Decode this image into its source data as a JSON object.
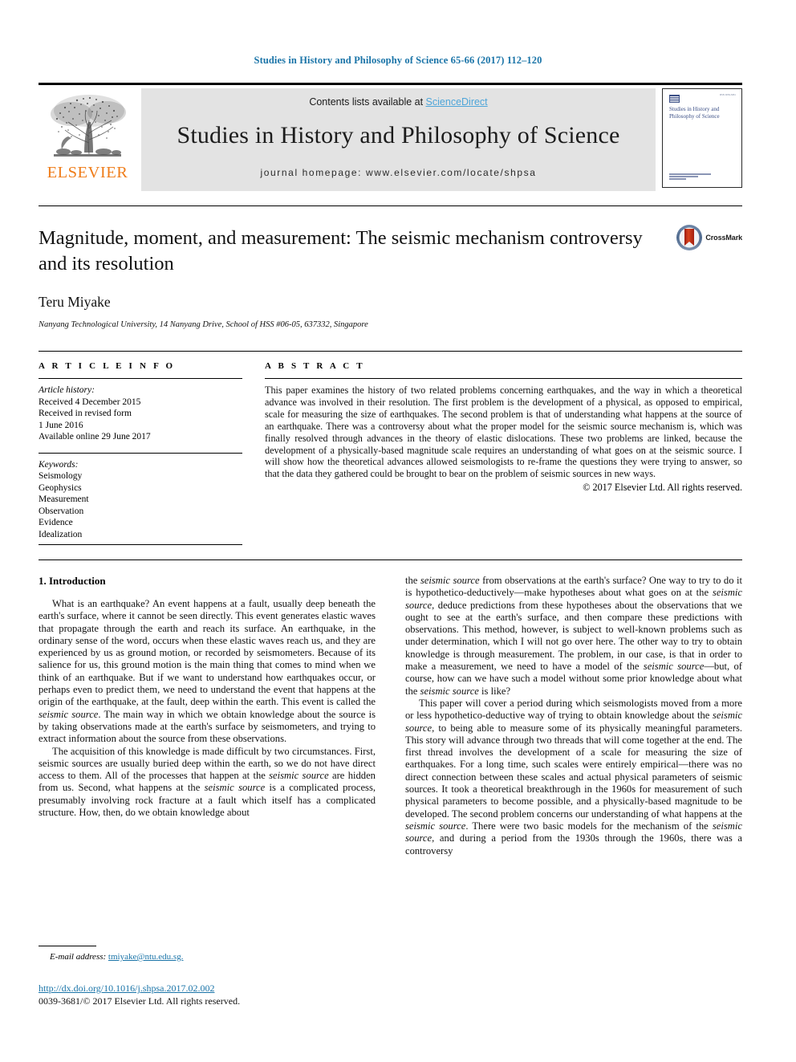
{
  "running_head": "Studies in History and Philosophy of Science 65-66 (2017) 112–120",
  "masthead": {
    "publisher_name": "ELSEVIER",
    "contents_prefix": "Contents lists available at ",
    "contents_link": "ScienceDirect",
    "journal_title": "Studies in History and Philosophy of Science",
    "homepage": "journal homepage: www.elsevier.com/locate/shpsa",
    "cover": {
      "title": "Studies in History and Philosophy of Science",
      "corner_note": "ISSN 0039-3681"
    }
  },
  "article": {
    "title": "Magnitude, moment, and measurement: The seismic mechanism controversy and its resolution",
    "author": "Teru Miyake",
    "affiliation": "Nanyang Technological University, 14 Nanyang Drive, School of HSS #06-05, 637332, Singapore",
    "crossmark_label": "CrossMark"
  },
  "article_info": {
    "heading": "A R T I C L E   I N F O",
    "history_label": "Article history:",
    "history": [
      "Received 4 December 2015",
      "Received in revised form",
      "1 June 2016",
      "Available online 29 June 2017"
    ],
    "keywords_label": "Keywords:",
    "keywords": [
      "Seismology",
      "Geophysics",
      "Measurement",
      "Observation",
      "Evidence",
      "Idealization"
    ]
  },
  "abstract": {
    "heading": "A B S T R A C T",
    "text": "This paper examines the history of two related problems concerning earthquakes, and the way in which a theoretical advance was involved in their resolution. The first problem is the development of a physical, as opposed to empirical, scale for measuring the size of earthquakes. The second problem is that of understanding what happens at the source of an earthquake. There was a controversy about what the proper model for the seismic source mechanism is, which was finally resolved through advances in the theory of elastic dislocations. These two problems are linked, because the development of a physically-based magnitude scale requires an understanding of what goes on at the seismic source. I will show how the theoretical advances allowed seismologists to re-frame the questions they were trying to answer, so that the data they gathered could be brought to bear on the problem of seismic sources in new ways.",
    "copyright": "© 2017 Elsevier Ltd. All rights reserved."
  },
  "body": {
    "section_number_title": "1. Introduction",
    "left_paragraph_1": "What is an earthquake? An event happens at a fault, usually deep beneath the earth's surface, where it cannot be seen directly. This event generates elastic waves that propagate through the earth and reach its surface. An earthquake, in the ordinary sense of the word, occurs when these elastic waves reach us, and they are experienced by us as ground motion, or recorded by seismometers. Because of its salience for us, this ground motion is the main thing that comes to mind when we think of an earthquake. But if we want to understand how earthquakes occur, or perhaps even to predict them, we need to understand the event that happens at the origin of the earthquake, at the fault, deep within the earth. This event is called the ",
    "left_paragraph_1_italic": "seismic source",
    "left_paragraph_1_tail": ". The main way in which we obtain knowledge about the source is by taking observations made at the earth's surface by seismometers, and trying to extract information about the source from these observations.",
    "left_paragraph_2a": "The acquisition of this knowledge is made difficult by two circumstances. First, seismic sources are usually buried deep within the earth, so we do not have direct access to them. All of the processes that happen at the ",
    "left_paragraph_2_italic1": "seismic source",
    "left_paragraph_2b": " are hidden from us. Second, what happens at the ",
    "left_paragraph_2_italic2": "seismic source",
    "left_paragraph_2c": " is a complicated process, presumably involving rock fracture at a fault which itself has a complicated structure. How, then, do we obtain knowledge about",
    "right_paragraph_1a": "the ",
    "right_paragraph_1_italic1": "seismic source",
    "right_paragraph_1b": " from observations at the earth's surface? One way to try to do it is hypothetico-deductively—make hypotheses about what goes on at the ",
    "right_paragraph_1_italic2": "seismic source",
    "right_paragraph_1c": ", deduce predictions from these hypotheses about the observations that we ought to see at the earth's surface, and then compare these predictions with observations. This method, however, is subject to well-known problems such as under determination, which I will not go over here. The other way to try to obtain knowledge is through measurement. The problem, in our case, is that in order to make a measurement, we need to have a model of the ",
    "right_paragraph_1_italic3": "seismic source",
    "right_paragraph_1d": "—but, of course, how can we have such a model without some prior knowledge about what the ",
    "right_paragraph_1_italic4": "seismic source",
    "right_paragraph_1e": " is like?",
    "right_paragraph_2a": "This paper will cover a period during which seismologists moved from a more or less hypothetico-deductive way of trying to obtain knowledge about the ",
    "right_paragraph_2_italic1": "seismic source",
    "right_paragraph_2b": ", to being able to measure some of its physically meaningful parameters. This story will advance through two threads that will come together at the end. The first thread involves the development of a scale for measuring the size of earthquakes. For a long time, such scales were entirely empirical—there was no direct connection between these scales and actual physical parameters of seismic sources. It took a theoretical breakthrough in the 1960s for measurement of such physical parameters to become possible, and a physically-based magnitude to be developed. The second problem concerns our understanding of what happens at the ",
    "right_paragraph_2_italic2": "seismic source",
    "right_paragraph_2c": ". There were two basic models for the mechanism of the ",
    "right_paragraph_2_italic3": "seismic source",
    "right_paragraph_2d": ", and during a period from the 1930s through the 1960s, there was a controversy"
  },
  "footer": {
    "email_label": "E-mail address:",
    "email": "tmiyake@ntu.edu.sg.",
    "doi": "http://dx.doi.org/10.1016/j.shpsa.2017.02.002",
    "issn_copyright": "0039-3681/© 2017 Elsevier Ltd. All rights reserved."
  },
  "colors": {
    "link": "#1a74a8",
    "sciencedirect": "#4da5d9",
    "elsevier_orange": "#ef7d1a",
    "band_gray": "#e3e3e3"
  }
}
